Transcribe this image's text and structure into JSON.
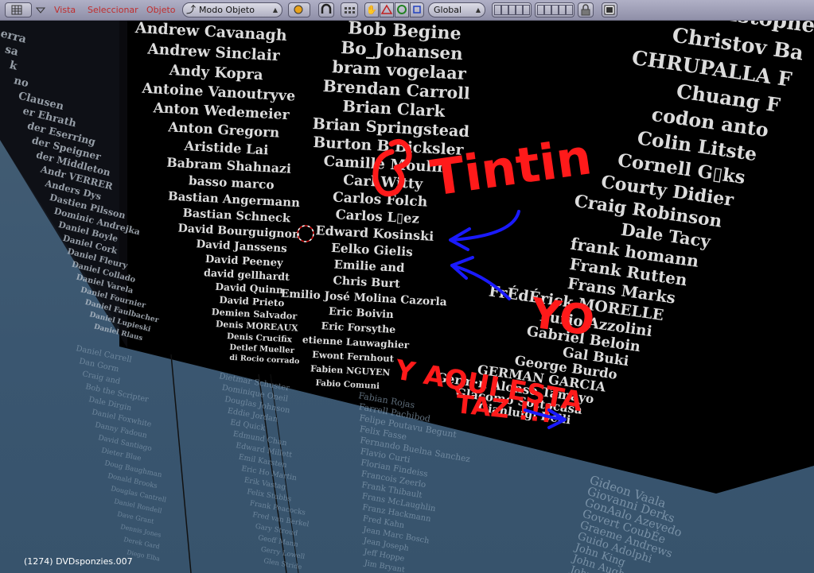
{
  "header": {
    "menus": [
      "Vista",
      "Seleccionar",
      "Objeto"
    ],
    "mode_select": "Modo Objeto",
    "pivot_select": "Global"
  },
  "credits": {
    "col1": [
      "Andrew Cavanagh",
      "Andrew Sinclair",
      "Andy Kopra",
      "Antoine Vanoutryve",
      "Anton Wedemeier",
      "Anton Gregorn",
      "Aristide Lai",
      "Babram Shahnazi",
      "basso marco",
      "Bastian Angermann",
      "Bastian Schneck",
      "David Bourguignon",
      "David Janssens",
      "David Peeney",
      "david gellhardt",
      "David Quinn",
      "David Prieto",
      "Demien Salvador",
      "Denis MOREAUX",
      "Denis Crucifix",
      "Detlef Mueller",
      "di Rocio corrado"
    ],
    "col2": [
      "Bob Begine",
      "Bo_Johansen",
      "bram vogelaar",
      "Brendan Carroll",
      "Brian Clark",
      "Brian Springstead",
      "Burton B Bicksler",
      "Camille Moulin",
      "Carl Witty",
      "Carlos Folch",
      "Carlos L▯ez",
      "Edward Kosinski",
      "Eelko Gielis",
      "Emilie and",
      "Chris Burt",
      "Emilio José Molina Cazorla",
      "Eric Boivin",
      "Eric Forsythe",
      "etienne Lauwaghier",
      "Ewont Fernhout",
      "Fabien NGUYEN",
      "Fabio Comuni"
    ],
    "col3": [
      "Christophe",
      "Christov Ba",
      "CHRUPALLA F",
      "Chuang F",
      "codon anto",
      "Colin Litste",
      "Cornell G▯ks",
      "Courty Didier",
      "Craig Robinson",
      "Dale Tacy",
      "frank homann",
      "Frank Rutten",
      "Frans Marks",
      "FrÉdÉrick MORELLE",
      "Furio Azzolini",
      "Gabriel Beloin",
      "Gal Buki",
      "George Burdo",
      "GERMAN GARCIA",
      "Germ·n Alonso Tamayo",
      "Glacomo Sottocasa",
      "Gianluigi Belli"
    ],
    "side": [
      "erra",
      "sa",
      "k",
      "no",
      "Clausen",
      "er Ehrath",
      "der Eserring",
      "der Speigner",
      "der Middleton",
      "Andr VERRER",
      "Anders Dys",
      "Dastien Pilsson",
      "Dominic Andrejka",
      "Daniel Boyle",
      "Daniel Cork",
      "Daniel Fleury",
      "Daniel Collado",
      "Daniel Varela",
      "Daniel Fournier",
      "Daniel Faulbacher",
      "Daniel Lupieski",
      "Daniel Rlaus"
    ],
    "reflection_left": [
      "Daniel Carrell",
      "Dan Gorm",
      "Craig and",
      "Bob the Scripter",
      "Dale Dirgin",
      "Daniel Foxwhite",
      "Danny Fadoun",
      "David Santiago",
      "Dieter Blue",
      "Doug Baughman",
      "Donald Brooks",
      "Douglas Cantrell",
      "Daniel Rondell",
      "Dave Grant",
      "Dennis Jones",
      "Derek Gard",
      "Diego Elba"
    ],
    "reflection_mid": [
      "Dietmar Schuster",
      "Dominique Oneil",
      "Douglas Johnson",
      "Eddie Jordan",
      "Ed Quick",
      "Edmund Chan",
      "Edward Millett",
      "Emil Karsten",
      "Eric Ho Martin",
      "Erik Vastag",
      "Felix Stubbs",
      "Frank Peacocks",
      "Fred van Berkel",
      "Gary Stroud",
      "Geoff Mann",
      "Gerry Lowell",
      "Glen Stride"
    ],
    "reflection_right": [
      "Fabian Rojas",
      "Farrell Pachibod",
      "Felipe Poutavu Begunt",
      "Felix Fasse",
      "Fernando Buelna Sanchez",
      "Flavio Curti",
      "Florian Findeiss",
      "Francois Zeerlo",
      "Frank Thibault",
      "Frans McLaughlin",
      "Franz Hackmann",
      "Fred Kahn",
      "Jean Marc Bosch",
      "Jean Joseph",
      "Jeff Hoppe",
      "Jim Bryant"
    ],
    "reflection_far": [
      "Gideon Vaala",
      "Giovanni Derks",
      "GonAalo Azevedo",
      "Govert CoubÉe",
      "Graeme Andrews",
      "Guido Adolphi",
      "John King",
      "John Aughey",
      "John Dillon"
    ]
  },
  "annotations": {
    "tintin": "Tintin",
    "yo": "YO",
    "aqui": "Y AQUI ESTA",
    "taz": "TAZ !!!"
  },
  "status": "(1274) DVDsponzies.007"
}
